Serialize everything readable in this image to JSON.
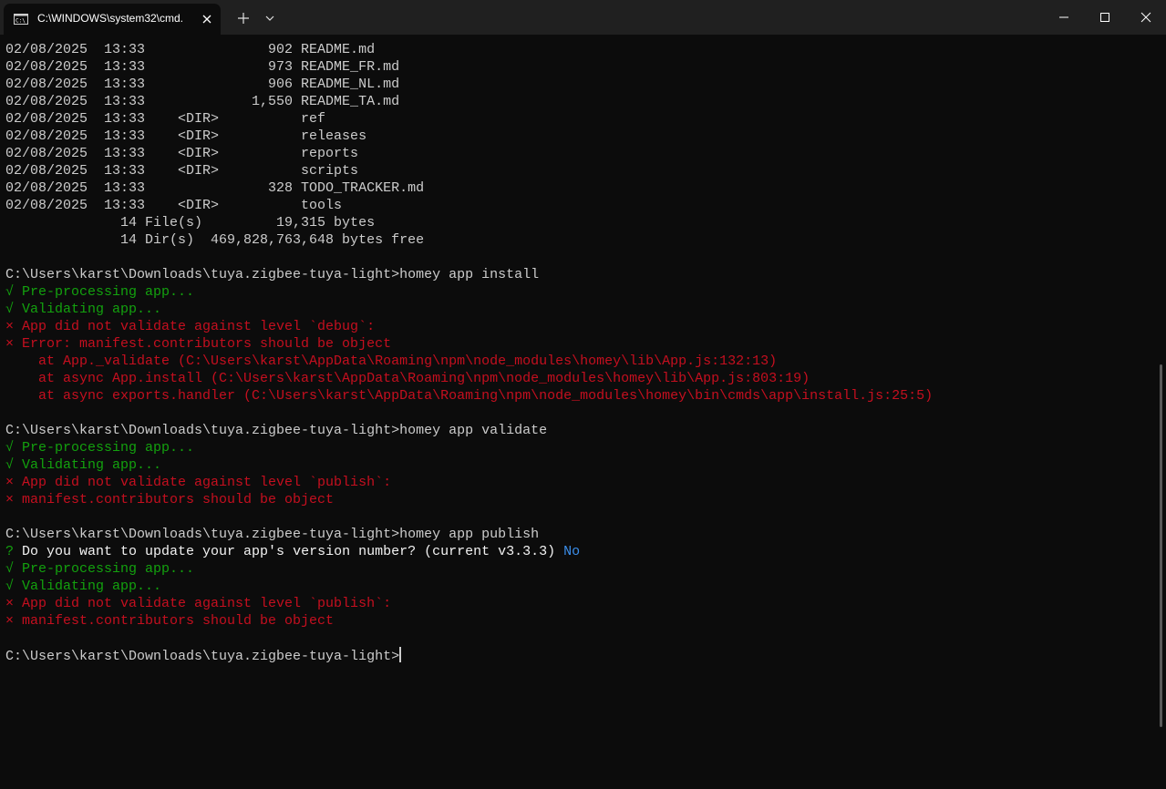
{
  "window": {
    "tab_title": "C:\\WINDOWS\\system32\\cmd.",
    "tab_icon": "cmd-icon",
    "colors": {
      "background": "#0c0c0c",
      "titlebar": "#202020",
      "default_text": "#cccccc",
      "success": "#13a10e",
      "error": "#c50f1f",
      "answer": "#3b8eea"
    }
  },
  "terminal": {
    "lines": [
      {
        "type": "default",
        "text": "02/08/2025  13:33               902 README.md"
      },
      {
        "type": "default",
        "text": "02/08/2025  13:33               973 README_FR.md"
      },
      {
        "type": "default",
        "text": "02/08/2025  13:33               906 README_NL.md"
      },
      {
        "type": "default",
        "text": "02/08/2025  13:33             1,550 README_TA.md"
      },
      {
        "type": "default",
        "text": "02/08/2025  13:33    <DIR>          ref"
      },
      {
        "type": "default",
        "text": "02/08/2025  13:33    <DIR>          releases"
      },
      {
        "type": "default",
        "text": "02/08/2025  13:33    <DIR>          reports"
      },
      {
        "type": "default",
        "text": "02/08/2025  13:33    <DIR>          scripts"
      },
      {
        "type": "default",
        "text": "02/08/2025  13:33               328 TODO_TRACKER.md"
      },
      {
        "type": "default",
        "text": "02/08/2025  13:33    <DIR>          tools"
      },
      {
        "type": "default",
        "text": "              14 File(s)         19,315 bytes"
      },
      {
        "type": "default",
        "text": "              14 Dir(s)  469,828,763,648 bytes free"
      },
      {
        "type": "default",
        "text": ""
      },
      {
        "type": "default",
        "text": "C:\\Users\\karst\\Downloads\\tuya.zigbee-tuya-light>homey app install"
      },
      {
        "type": "green",
        "text": "√ Pre-processing app..."
      },
      {
        "type": "green",
        "text": "√ Validating app..."
      },
      {
        "type": "red",
        "text": "× App did not validate against level `debug`:"
      },
      {
        "type": "red",
        "text": "× Error: manifest.contributors should be object"
      },
      {
        "type": "red",
        "text": "    at App._validate (C:\\Users\\karst\\AppData\\Roaming\\npm\\node_modules\\homey\\lib\\App.js:132:13)"
      },
      {
        "type": "red",
        "text": "    at async App.install (C:\\Users\\karst\\AppData\\Roaming\\npm\\node_modules\\homey\\lib\\App.js:803:19)"
      },
      {
        "type": "red",
        "text": "    at async exports.handler (C:\\Users\\karst\\AppData\\Roaming\\npm\\node_modules\\homey\\bin\\cmds\\app\\install.js:25:5)"
      },
      {
        "type": "default",
        "text": ""
      },
      {
        "type": "default",
        "text": "C:\\Users\\karst\\Downloads\\tuya.zigbee-tuya-light>homey app validate"
      },
      {
        "type": "green",
        "text": "√ Pre-processing app..."
      },
      {
        "type": "green",
        "text": "√ Validating app..."
      },
      {
        "type": "red",
        "text": "× App did not validate against level `publish`:"
      },
      {
        "type": "red",
        "text": "× manifest.contributors should be object"
      },
      {
        "type": "default",
        "text": ""
      },
      {
        "type": "default",
        "text": "C:\\Users\\karst\\Downloads\\tuya.zigbee-tuya-light>homey app publish"
      },
      {
        "type": "question",
        "prefix": "? ",
        "text": "Do you want to update your app's version number? (current v3.3.3) ",
        "answer": "No"
      },
      {
        "type": "green",
        "text": "√ Pre-processing app..."
      },
      {
        "type": "green",
        "text": "√ Validating app..."
      },
      {
        "type": "red",
        "text": "× App did not validate against level `publish`:"
      },
      {
        "type": "red",
        "text": "× manifest.contributors should be object"
      },
      {
        "type": "default",
        "text": ""
      }
    ],
    "prompt": "C:\\Users\\karst\\Downloads\\tuya.zigbee-tuya-light>"
  }
}
